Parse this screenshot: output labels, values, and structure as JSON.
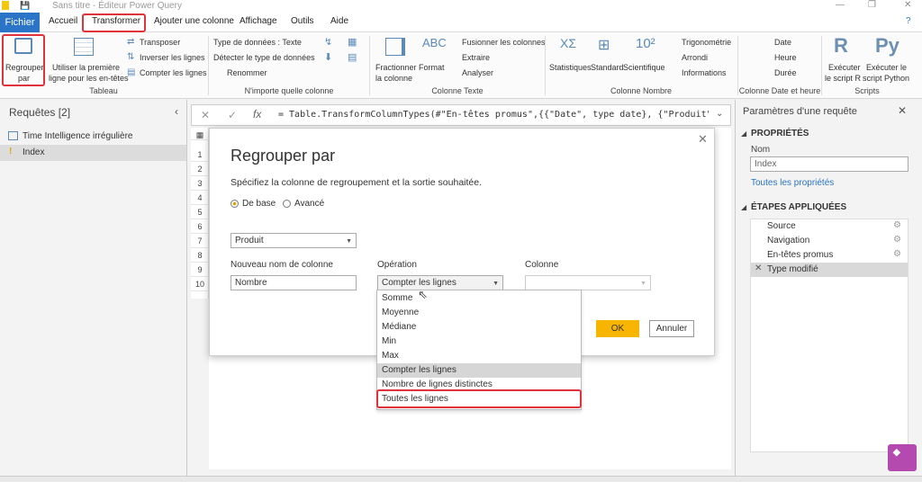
{
  "titlebar": {
    "title": "Sans titre - Éditeur Power Query",
    "minimize": "—",
    "restore": "❐",
    "close": "✕"
  },
  "menu": {
    "fichier": "Fichier",
    "accueil": "Accueil",
    "transformer": "Transformer",
    "ajouter": "Ajouter une colonne",
    "affichage": "Affichage",
    "outils": "Outils",
    "aide": "Aide"
  },
  "ribbon": {
    "regrouper_l1": "Regrouper",
    "regrouper_l2": "par",
    "utiliser_l1": "Utiliser la première",
    "utiliser_l2": "ligne pour les en-têtes",
    "transposer": "Transposer",
    "inverser": "Inverser les lignes",
    "compter": "Compter les lignes",
    "tableau": "Tableau",
    "type_donnees": "Type de données : Texte",
    "detecter": "Détecter le type de données",
    "renommer": "Renommer",
    "importe": "N'importe quelle colonne",
    "fractionner_l1": "Fractionner",
    "fractionner_l2": "la colonne",
    "format": "Format",
    "fusionner": "Fusionner les colonnes",
    "extraire": "Extraire",
    "analyser": "Analyser",
    "colonne_texte": "Colonne Texte",
    "statistiques": "Statistiques",
    "standard": "Standard",
    "scientifique": "Scientifique",
    "trigonometrie": "Trigonométrie",
    "arrondi": "Arrondi",
    "informations": "Informations",
    "colonne_nombre": "Colonne Nombre",
    "date": "Date",
    "heure": "Heure",
    "duree": "Durée",
    "colonne_date": "Colonne Date et heure",
    "exec_r_l1": "Exécuter",
    "exec_r_l2": "le script R",
    "exec_py_l1": "Exécuter le",
    "exec_py_l2": "script Python",
    "scripts": "Scripts"
  },
  "queries": {
    "header": "Requêtes [2]",
    "items": [
      "Time Intelligence irrégulière",
      "Index"
    ]
  },
  "formula": {
    "text": "= Table.TransformColumnTypes(#\"En-têtes promus\",{{\"Date\", type date}, {\"Produit\", type"
  },
  "grid": {
    "rows": [
      "1",
      "2",
      "3",
      "4",
      "5",
      "6",
      "7",
      "8",
      "9",
      "10"
    ]
  },
  "params": {
    "header": "Paramètres d'une requête",
    "proprietes": "PROPRIÉTÉS",
    "nom_label": "Nom",
    "nom_value": "Index",
    "toutes": "Toutes les propriétés",
    "etapes": "ÉTAPES APPLIQUÉES",
    "steps": [
      "Source",
      "Navigation",
      "En-têtes promus",
      "Type modifié"
    ]
  },
  "dialog": {
    "title": "Regrouper par",
    "subtitle": "Spécifiez la colonne de regroupement et la sortie souhaitée.",
    "radio_base": "De base",
    "radio_avance": "Avancé",
    "group_column": "Produit",
    "new_col_label": "Nouveau nom de colonne",
    "new_col_value": "Nombre",
    "operation_label": "Opération",
    "operation_value": "Compter les lignes",
    "colonne_label": "Colonne",
    "ok": "OK",
    "annuler": "Annuler",
    "operations": [
      "Somme",
      "Moyenne",
      "Médiane",
      "Min",
      "Max",
      "Compter les lignes",
      "Nombre de lignes distinctes",
      "Toutes les lignes"
    ]
  },
  "colors": {
    "accent": "#2b74c7",
    "highlight": "#e0323b",
    "ok": "#f7b500"
  }
}
